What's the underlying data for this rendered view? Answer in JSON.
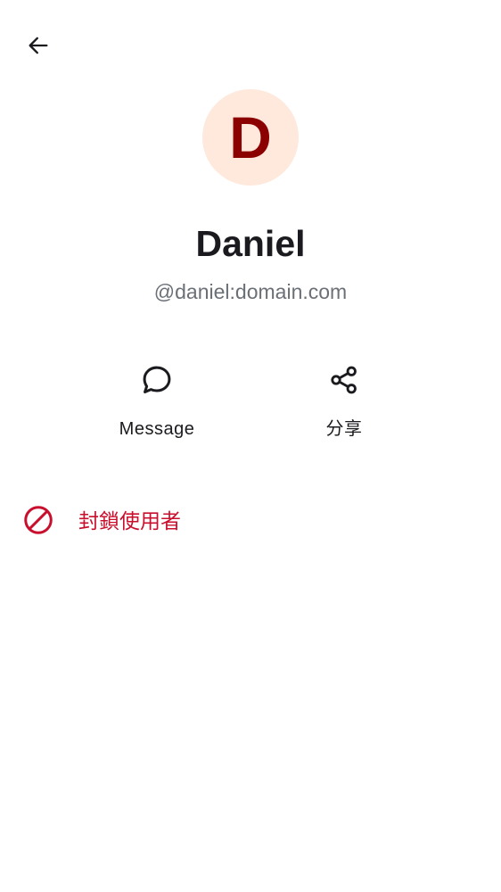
{
  "header": {
    "back_icon": "arrow-back-icon"
  },
  "profile": {
    "avatar_letter": "D",
    "avatar_bg_color": "#ffe8dc",
    "avatar_letter_color": "#8b0000",
    "display_name": "Daniel",
    "user_id": "@daniel:domain.com"
  },
  "actions": [
    {
      "label": "Message",
      "icon": "chat-bubble-icon"
    },
    {
      "label": "分享",
      "icon": "share-icon"
    }
  ],
  "danger_actions": {
    "block_user_label": "封鎖使用者",
    "block_icon": "block-icon",
    "color": "#c8102e"
  }
}
